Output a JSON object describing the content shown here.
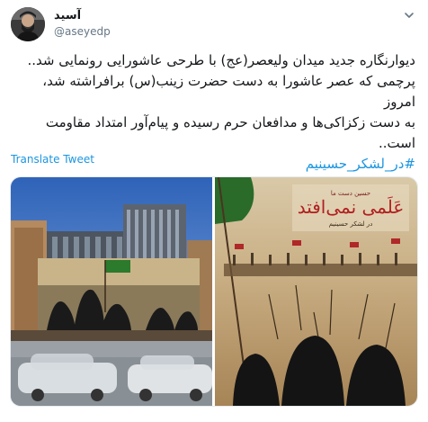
{
  "tweet": {
    "author_name": "آسید",
    "author_handle": "@aseyedp",
    "lines": [
      "دیوارنگاره جدید میدان ولیعصر(عج) با طرحی عاشورایی رونمایی شد..",
      "پرچمی که عصر عاشورا به دست حضرت زینب(س) برافراشته شد، امروز",
      "به دست زکزاکی‌ها و مدافعان حرم رسیده و پیام‌آور امتداد مقاومت است.."
    ],
    "hashtag": "#در_لشکر_حسینیم",
    "translate_label": "Translate Tweet"
  },
  "media": {
    "left_image": "billboard-mural-photo",
    "right_image": "ashura-mural-artwork",
    "poster_title": "عَلَمی نمی‌افتد",
    "poster_small_top": "حسین دست ما",
    "poster_small_bottom": "در لشکر حسینیم"
  },
  "colors": {
    "link": "#1b95e0",
    "text": "#14171a",
    "secondary": "#657786"
  }
}
